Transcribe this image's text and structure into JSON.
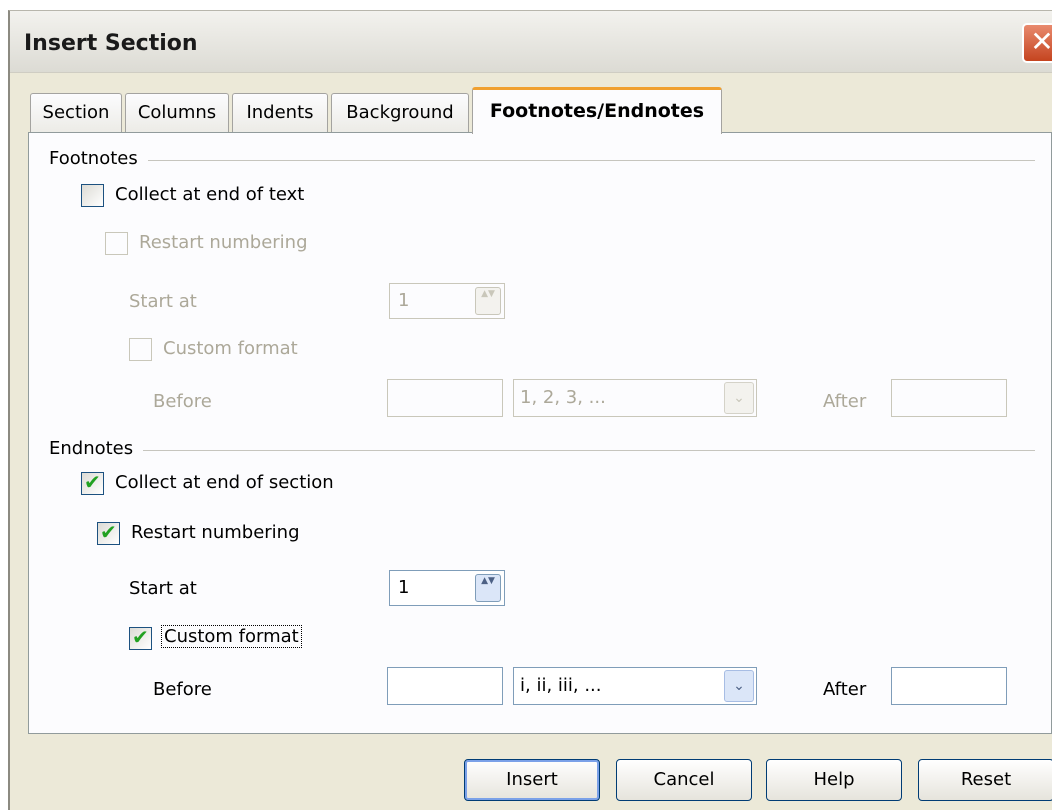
{
  "window": {
    "title": "Insert Section",
    "close_glyph": "✕"
  },
  "tabs": [
    {
      "label": "Section"
    },
    {
      "label": "Columns"
    },
    {
      "label": "Indents"
    },
    {
      "label": "Background"
    },
    {
      "label": "Footnotes/Endnotes",
      "active": true
    }
  ],
  "footnotes": {
    "group_label": "Footnotes",
    "collect_label": "Collect at end of text",
    "collect_checked": false,
    "restart_label": "Restart numbering",
    "restart_checked": false,
    "start_label": "Start at",
    "start_value": "1",
    "custom_label": "Custom format",
    "custom_checked": false,
    "before_label": "Before",
    "before_value": "",
    "format_value": "1, 2, 3, ...",
    "after_label": "After",
    "after_value": ""
  },
  "endnotes": {
    "group_label": "Endnotes",
    "collect_label": "Collect at end of section",
    "collect_checked": true,
    "restart_label": "Restart numbering",
    "restart_checked": true,
    "start_label": "Start at",
    "start_value": "1",
    "custom_label": "Custom format",
    "custom_checked": true,
    "before_label": "Before",
    "before_value": "",
    "format_value": "i, ii, iii, ...",
    "after_label": "After",
    "after_value": ""
  },
  "buttons": {
    "insert": "Insert",
    "cancel": "Cancel",
    "help": "Help",
    "reset": "Reset"
  },
  "icons": {
    "check": "✔",
    "spin": "▲▼",
    "dropdown": "⌄"
  }
}
